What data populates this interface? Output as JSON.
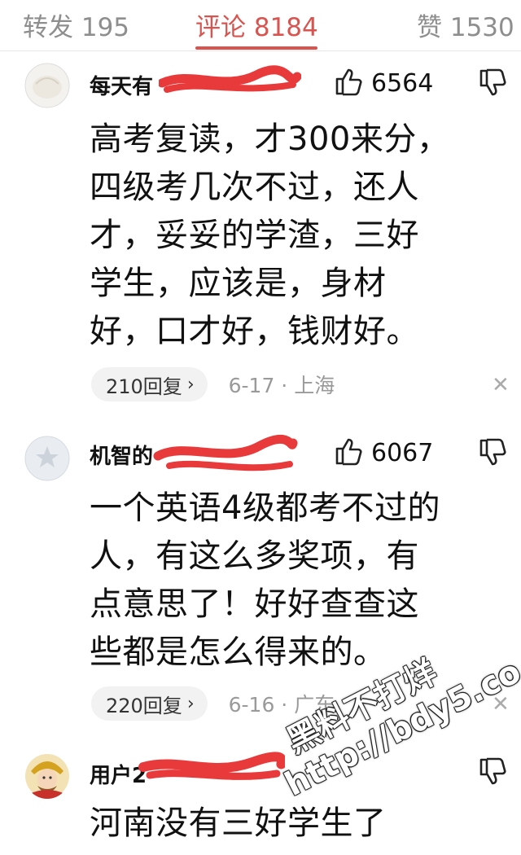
{
  "tabs": {
    "repost": "转发 195",
    "comments": "评论 8184",
    "likes": "赞 1530"
  },
  "comments": [
    {
      "username": "每天有",
      "likes": "6564",
      "lines": [
        "高考复读，才300来分，",
        "四级考几次不过，还人",
        "才，妥妥的学渣，三好",
        "学生，应该是，身材",
        "好，口才好，钱财好。"
      ],
      "replies": "210回复",
      "time_location": "6-17 · 上海"
    },
    {
      "username": "机智的",
      "likes": "6067",
      "lines": [
        "一个英语4级都考不过的",
        "人，有这么多奖项，有",
        "点意思了！好好查查这",
        "些都是怎么得来的。"
      ],
      "replies": "220回复",
      "time_location": "6-16 · 广东"
    },
    {
      "username": "用户2",
      "lines": [
        "河南没有三好学生了"
      ]
    }
  ],
  "watermark": {
    "line1": "黑料不打烊",
    "line2": "http://bdy5.co"
  },
  "icons": {
    "like": "thumbs-up-icon",
    "dislike": "thumbs-down-icon",
    "reply_arrow": "chevron-right-icon",
    "close": "close-icon"
  },
  "colors": {
    "accent": "#d9534f",
    "redaction": "#e83a3a"
  }
}
